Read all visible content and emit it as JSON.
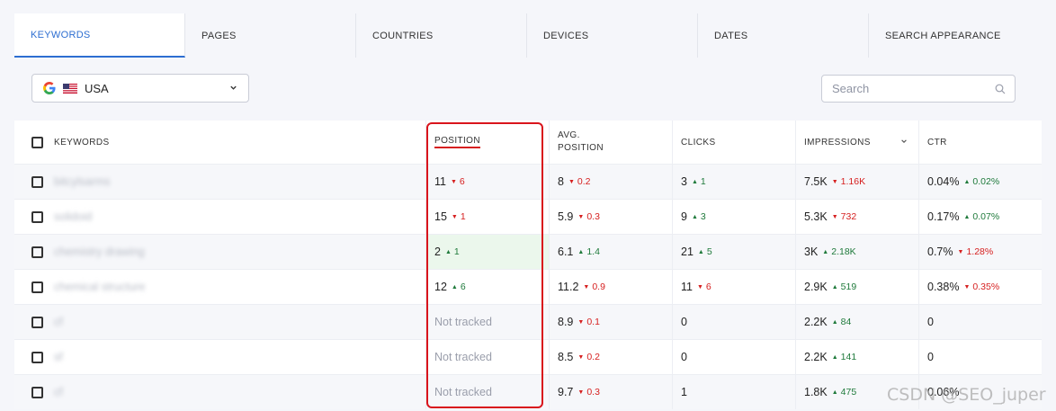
{
  "tabs": [
    "KEYWORDS",
    "PAGES",
    "COUNTRIES",
    "DEVICES",
    "DATES",
    "SEARCH APPEARANCE"
  ],
  "active_tab": "KEYWORDS",
  "region": {
    "label": "USA",
    "search_engine": "google-icon",
    "flag": "us-flag-icon"
  },
  "search": {
    "placeholder": "Search"
  },
  "columns": {
    "keywords": "KEYWORDS",
    "position": "POSITION",
    "avg_position_line1": "AVG.",
    "avg_position_line2": "POSITION",
    "clicks": "CLICKS",
    "impressions": "IMPRESSIONS",
    "ctr": "CTR"
  },
  "rows": [
    {
      "keyword": "bitcylsarms",
      "position": "11",
      "position_change": "6",
      "position_dir": "down",
      "avg": "8",
      "avg_change": "0.2",
      "avg_dir": "down",
      "clicks": "3",
      "clicks_change": "1",
      "clicks_dir": "up",
      "impressions": "7.5K",
      "impressions_change": "1.16K",
      "impressions_dir": "down",
      "ctr": "0.04%",
      "ctr_change": "0.02%",
      "ctr_dir": "up"
    },
    {
      "keyword": "solidoid",
      "position": "15",
      "position_change": "1",
      "position_dir": "down",
      "avg": "5.9",
      "avg_change": "0.3",
      "avg_dir": "down",
      "clicks": "9",
      "clicks_change": "3",
      "clicks_dir": "up",
      "impressions": "5.3K",
      "impressions_change": "732",
      "impressions_dir": "down",
      "ctr": "0.17%",
      "ctr_change": "0.07%",
      "ctr_dir": "up"
    },
    {
      "keyword": "chemistry drawing",
      "position": "2",
      "position_change": "1",
      "position_dir": "up",
      "avg": "6.1",
      "avg_change": "1.4",
      "avg_dir": "up",
      "clicks": "21",
      "clicks_change": "5",
      "clicks_dir": "up",
      "impressions": "3K",
      "impressions_change": "2.18K",
      "impressions_dir": "up",
      "ctr": "0.7%",
      "ctr_change": "1.28%",
      "ctr_dir": "down"
    },
    {
      "keyword": "chemical structure",
      "position": "12",
      "position_change": "6",
      "position_dir": "up",
      "avg": "11.2",
      "avg_change": "0.9",
      "avg_dir": "down",
      "clicks": "11",
      "clicks_change": "6",
      "clicks_dir": "down",
      "impressions": "2.9K",
      "impressions_change": "519",
      "impressions_dir": "up",
      "ctr": "0.38%",
      "ctr_change": "0.35%",
      "ctr_dir": "down"
    },
    {
      "keyword": "cf",
      "position": "Not tracked",
      "position_change": "",
      "position_dir": "",
      "avg": "8.9",
      "avg_change": "0.1",
      "avg_dir": "down",
      "clicks": "0",
      "clicks_change": "",
      "clicks_dir": "",
      "impressions": "2.2K",
      "impressions_change": "84",
      "impressions_dir": "up",
      "ctr": "0",
      "ctr_change": "",
      "ctr_dir": ""
    },
    {
      "keyword": "sf",
      "position": "Not tracked",
      "position_change": "",
      "position_dir": "",
      "avg": "8.5",
      "avg_change": "0.2",
      "avg_dir": "down",
      "clicks": "0",
      "clicks_change": "",
      "clicks_dir": "",
      "impressions": "2.2K",
      "impressions_change": "141",
      "impressions_dir": "up",
      "ctr": "0",
      "ctr_change": "",
      "ctr_dir": ""
    },
    {
      "keyword": "cf",
      "position": "Not tracked",
      "position_change": "",
      "position_dir": "",
      "avg": "9.7",
      "avg_change": "0.3",
      "avg_dir": "down",
      "clicks": "1",
      "clicks_change": "",
      "clicks_dir": "",
      "impressions": "1.8K",
      "impressions_change": "475",
      "impressions_dir": "up",
      "ctr": "0.06%",
      "ctr_change": "",
      "ctr_dir": ""
    }
  ],
  "highlighted_row": 2,
  "colors": {
    "accent": "#2d6ed1",
    "up": "#1f7a3b",
    "down": "#d62020",
    "annotation": "#d9141c"
  },
  "watermark": "CSDN @SEO_juper"
}
